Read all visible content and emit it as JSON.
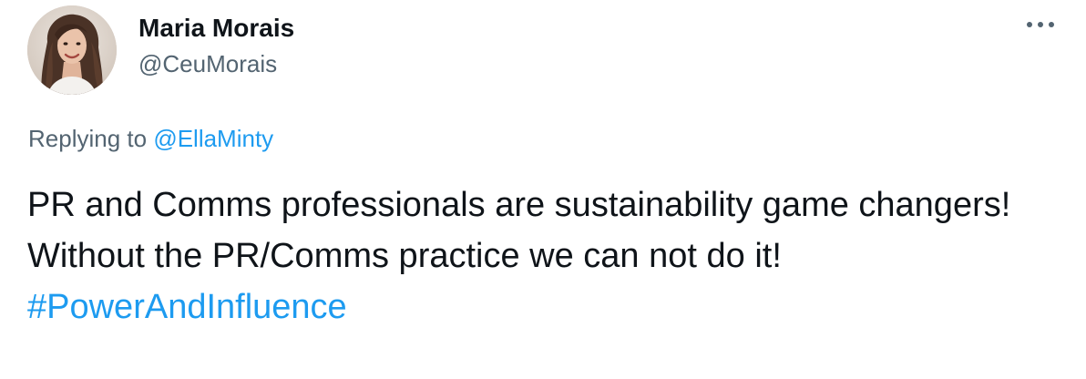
{
  "author": {
    "display_name": "Maria Morais",
    "handle": "@CeuMorais"
  },
  "more_menu": {
    "icon": "more-horizontal-icon"
  },
  "reply": {
    "prefix": "Replying to",
    "mention": "@EllaMinty"
  },
  "tweet": {
    "text": "PR and Comms professionals are sustainability game changers! Without the PR/Comms practice we can not do it!",
    "hashtag": "#PowerAndInfluence"
  },
  "colors": {
    "link": "#1d9bf0",
    "secondary_text": "#536471",
    "primary_text": "#0f1419"
  }
}
